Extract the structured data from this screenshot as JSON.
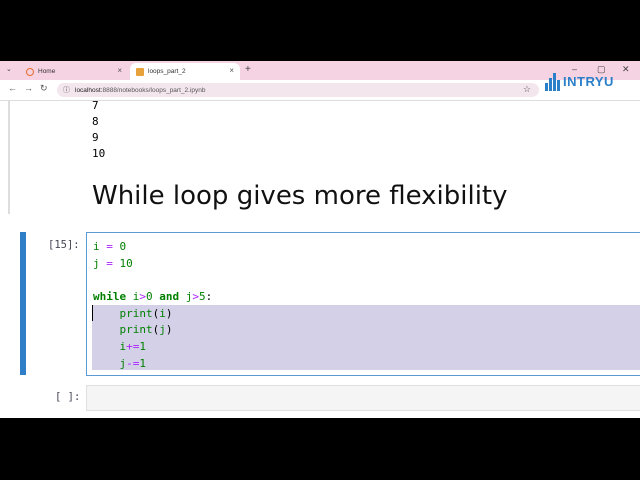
{
  "tabs": [
    {
      "label": "Home"
    },
    {
      "label": "loops_part_2"
    }
  ],
  "address": {
    "host": "localhost:",
    "path": "8888/notebooks/loops_part_2.ipynb"
  },
  "logo": {
    "text": "INTRYU"
  },
  "output": {
    "lines": [
      "7",
      "8",
      "9",
      "10"
    ]
  },
  "heading": "While loop gives more flexibility",
  "cell": {
    "prompt": "[15]:",
    "code": [
      {
        "tokens": [
          [
            "n",
            "i"
          ],
          [
            "sp",
            " "
          ],
          [
            "o",
            "="
          ],
          [
            "sp",
            " "
          ],
          [
            "n",
            "0"
          ]
        ]
      },
      {
        "tokens": [
          [
            "n",
            "j"
          ],
          [
            "sp",
            " "
          ],
          [
            "o",
            "="
          ],
          [
            "sp",
            " "
          ],
          [
            "n",
            "10"
          ]
        ]
      },
      {
        "tokens": []
      },
      {
        "tokens": [
          [
            "k",
            "while"
          ],
          [
            "sp",
            " "
          ],
          [
            "n",
            "i"
          ],
          [
            "o",
            ">"
          ],
          [
            "n",
            "0"
          ],
          [
            "sp",
            " "
          ],
          [
            "k",
            "and"
          ],
          [
            "sp",
            " "
          ],
          [
            "n",
            "j"
          ],
          [
            "o",
            ">"
          ],
          [
            "n",
            "5"
          ],
          [
            "sp",
            ":"
          ]
        ]
      },
      {
        "tokens": [
          [
            "sp",
            "    "
          ],
          [
            "n",
            "print"
          ],
          [
            "sp",
            "("
          ],
          [
            "n",
            "i"
          ],
          [
            "sp",
            ")"
          ]
        ]
      },
      {
        "tokens": [
          [
            "sp",
            "    "
          ],
          [
            "n",
            "print"
          ],
          [
            "sp",
            "("
          ],
          [
            "n",
            "j"
          ],
          [
            "sp",
            ")"
          ]
        ]
      },
      {
        "tokens": [
          [
            "sp",
            "    "
          ],
          [
            "n",
            "i"
          ],
          [
            "o",
            "+="
          ],
          [
            "n",
            "1"
          ]
        ]
      },
      {
        "tokens": [
          [
            "sp",
            "    "
          ],
          [
            "n",
            "j"
          ],
          [
            "o",
            "-="
          ],
          [
            "n",
            "1"
          ]
        ]
      }
    ]
  },
  "empty_cell": {
    "prompt": "[ ]:"
  },
  "colors": {
    "tabstrip": "#f6d3e2",
    "cell_marker": "#2f7fc8",
    "selection": "#d4d0e8",
    "keyword": "#008000",
    "operator": "#aa22ff"
  }
}
